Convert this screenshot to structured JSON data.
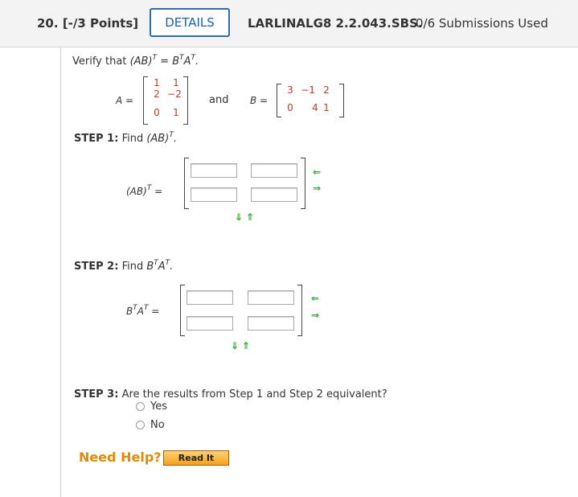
{
  "header": {
    "question_number": "20.",
    "points": "[-/3 Points]",
    "details_label": "DETAILS",
    "code": "LARLINALG8 2.2.043.SBS.",
    "submissions": "0/6 Submissions Used"
  },
  "prompt": {
    "verify": "Verify that",
    "expr_lhs": "(AB)",
    "expr_eq": "=",
    "expr_rhs": "B",
    "expr_rhs2": "A",
    "sup_t": "T",
    "period": "."
  },
  "matrices": {
    "A_label": "A =",
    "A": [
      [
        "1",
        "1"
      ],
      [
        "2",
        "−2"
      ],
      [
        "0",
        "1"
      ]
    ],
    "and": "and",
    "B_label": "B =",
    "B": [
      [
        "3",
        "−1",
        "2"
      ],
      [
        "0",
        "4",
        "1"
      ]
    ]
  },
  "step1": {
    "label": "STEP 1:",
    "text": "Find",
    "expr": "(AB)",
    "lhs": "(AB)",
    "eq": "="
  },
  "step2": {
    "label": "STEP 2:",
    "text": "Find",
    "expr_b": "B",
    "expr_a": "A",
    "lhs_b": "B",
    "lhs_a": "A",
    "eq": "="
  },
  "step3": {
    "label": "STEP 3:",
    "text": "Are the results from Step 1 and Step 2 equivalent?",
    "options": [
      "Yes",
      "No"
    ]
  },
  "help": {
    "need_help": "Need Help?",
    "read_it": "Read It"
  },
  "icons": {
    "arrow_left": "⇐",
    "arrow_right": "⇒",
    "arrow_down": "⇓",
    "arrow_up": "⇑"
  },
  "colors": {
    "accent": "#2f6db3",
    "matrix_entries": "#c0392b",
    "arrows": "#2aa12a",
    "help": "#e08a00"
  }
}
